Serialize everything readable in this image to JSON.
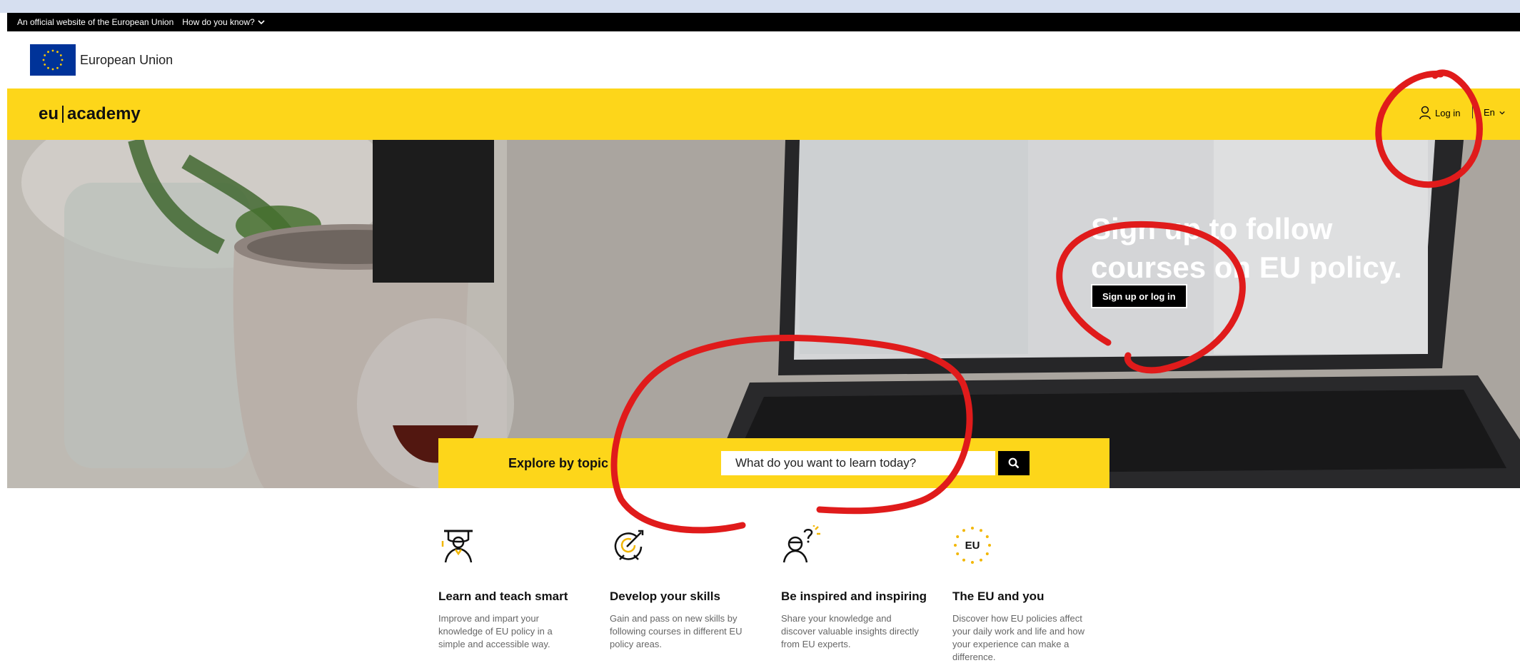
{
  "official_bar": {
    "notice": "An official website of the European Union",
    "how_label": "How do you know?"
  },
  "eu_header": {
    "name": "European Union"
  },
  "nav": {
    "brand_left": "eu",
    "brand_right": "academy",
    "login_label": "Log in",
    "language": "En"
  },
  "hero": {
    "title": "Sign up to follow courses on EU policy.",
    "button_label": "Sign up or log in"
  },
  "explore": {
    "label": "Explore by topic",
    "search_placeholder": "What do you want to learn today?"
  },
  "features": [
    {
      "icon": "teacher-icon",
      "title": "Learn and teach smart",
      "description": "Improve and impart your knowledge of EU policy in a simple and accessible way."
    },
    {
      "icon": "target-icon",
      "title": "Develop your skills",
      "description": "Gain and pass on new skills by following courses in different EU policy areas."
    },
    {
      "icon": "inspired-person-icon",
      "title": "Be inspired and inspiring",
      "description": "Share your knowledge and discover valuable insights directly from EU experts."
    },
    {
      "icon": "eu-stars-icon",
      "title": "The EU and you",
      "description": "Discover how EU policies affect your daily work and life and how your experience can make a difference."
    }
  ],
  "colors": {
    "accent_yellow": "#fdd61a",
    "eu_blue": "#003399",
    "annotation_red": "#e01b1b"
  }
}
